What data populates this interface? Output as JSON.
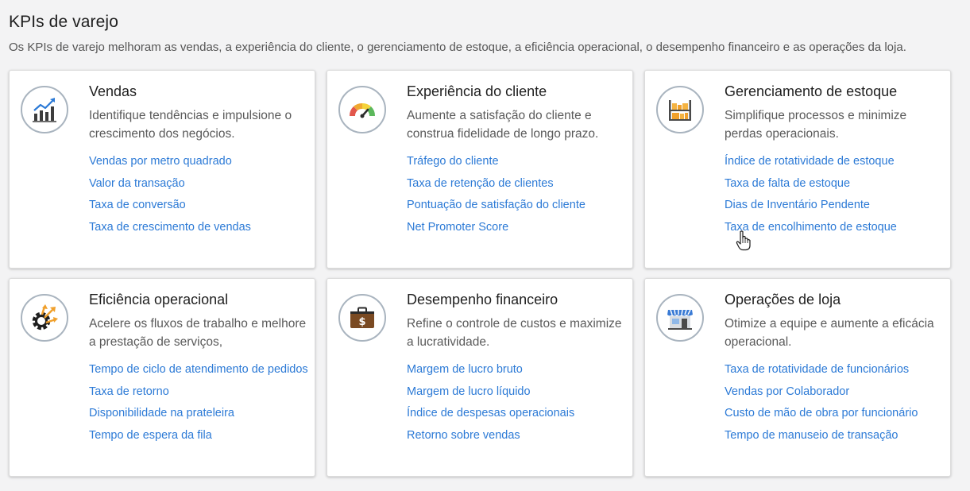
{
  "page": {
    "title": "KPIs de varejo",
    "subtitle": "Os KPIs de varejo melhoram as vendas, a experiência do cliente, o gerenciamento de estoque, a eficiência operacional, o desempenho financeiro e as operações da loja."
  },
  "colors": {
    "link": "#2c7ad6",
    "icon_ring": "#a9b4bf",
    "card_bg": "#ffffff",
    "page_bg": "#f3f3f4"
  },
  "cards": [
    {
      "icon": "sales-chart-icon",
      "title": "Vendas",
      "description": "Identifique tendências e impulsione o crescimento dos negócios.",
      "links": [
        "Vendas por metro quadrado",
        "Valor da transação",
        "Taxa de conversão",
        "Taxa de crescimento de vendas"
      ]
    },
    {
      "icon": "satisfaction-gauge-icon",
      "title": "Experiência do cliente",
      "description": "Aumente a satisfação do cliente e construa fidelidade de longo prazo.",
      "links": [
        "Tráfego do cliente",
        "Taxa de retenção de clientes",
        "Pontuação de satisfação do cliente",
        "Net Promoter Score"
      ]
    },
    {
      "icon": "inventory-shelf-icon",
      "title": "Gerenciamento de estoque",
      "description": "Simplifique processos e minimize perdas operacionais.",
      "links": [
        "Índice de rotatividade de estoque",
        "Taxa de falta de estoque",
        "Dias de Inventário Pendente",
        "Taxa de encolhimento de estoque"
      ]
    },
    {
      "icon": "gear-arrows-icon",
      "title": "Eficiência operacional",
      "description": "Acelere os fluxos de trabalho e melhore a prestação de serviços,",
      "links": [
        "Tempo de ciclo de atendimento de pedidos",
        "Taxa de retorno",
        "Disponibilidade na prateleira",
        "Tempo de espera da fila"
      ]
    },
    {
      "icon": "briefcase-dollar-icon",
      "title": "Desempenho financeiro",
      "description": "Refine o controle de custos e maximize a lucratividade.",
      "links": [
        "Margem de lucro bruto",
        "Margem de lucro líquido",
        "Índice de despesas operacionais",
        "Retorno sobre vendas"
      ]
    },
    {
      "icon": "storefront-icon",
      "title": "Operações de loja",
      "description": "Otimize a equipe e aumente a eficácia operacional.",
      "links": [
        "Taxa de rotatividade de funcionários",
        "Vendas por Colaborador",
        "Custo de mão de obra por funcionário",
        "Tempo de manuseio de transação"
      ]
    }
  ]
}
